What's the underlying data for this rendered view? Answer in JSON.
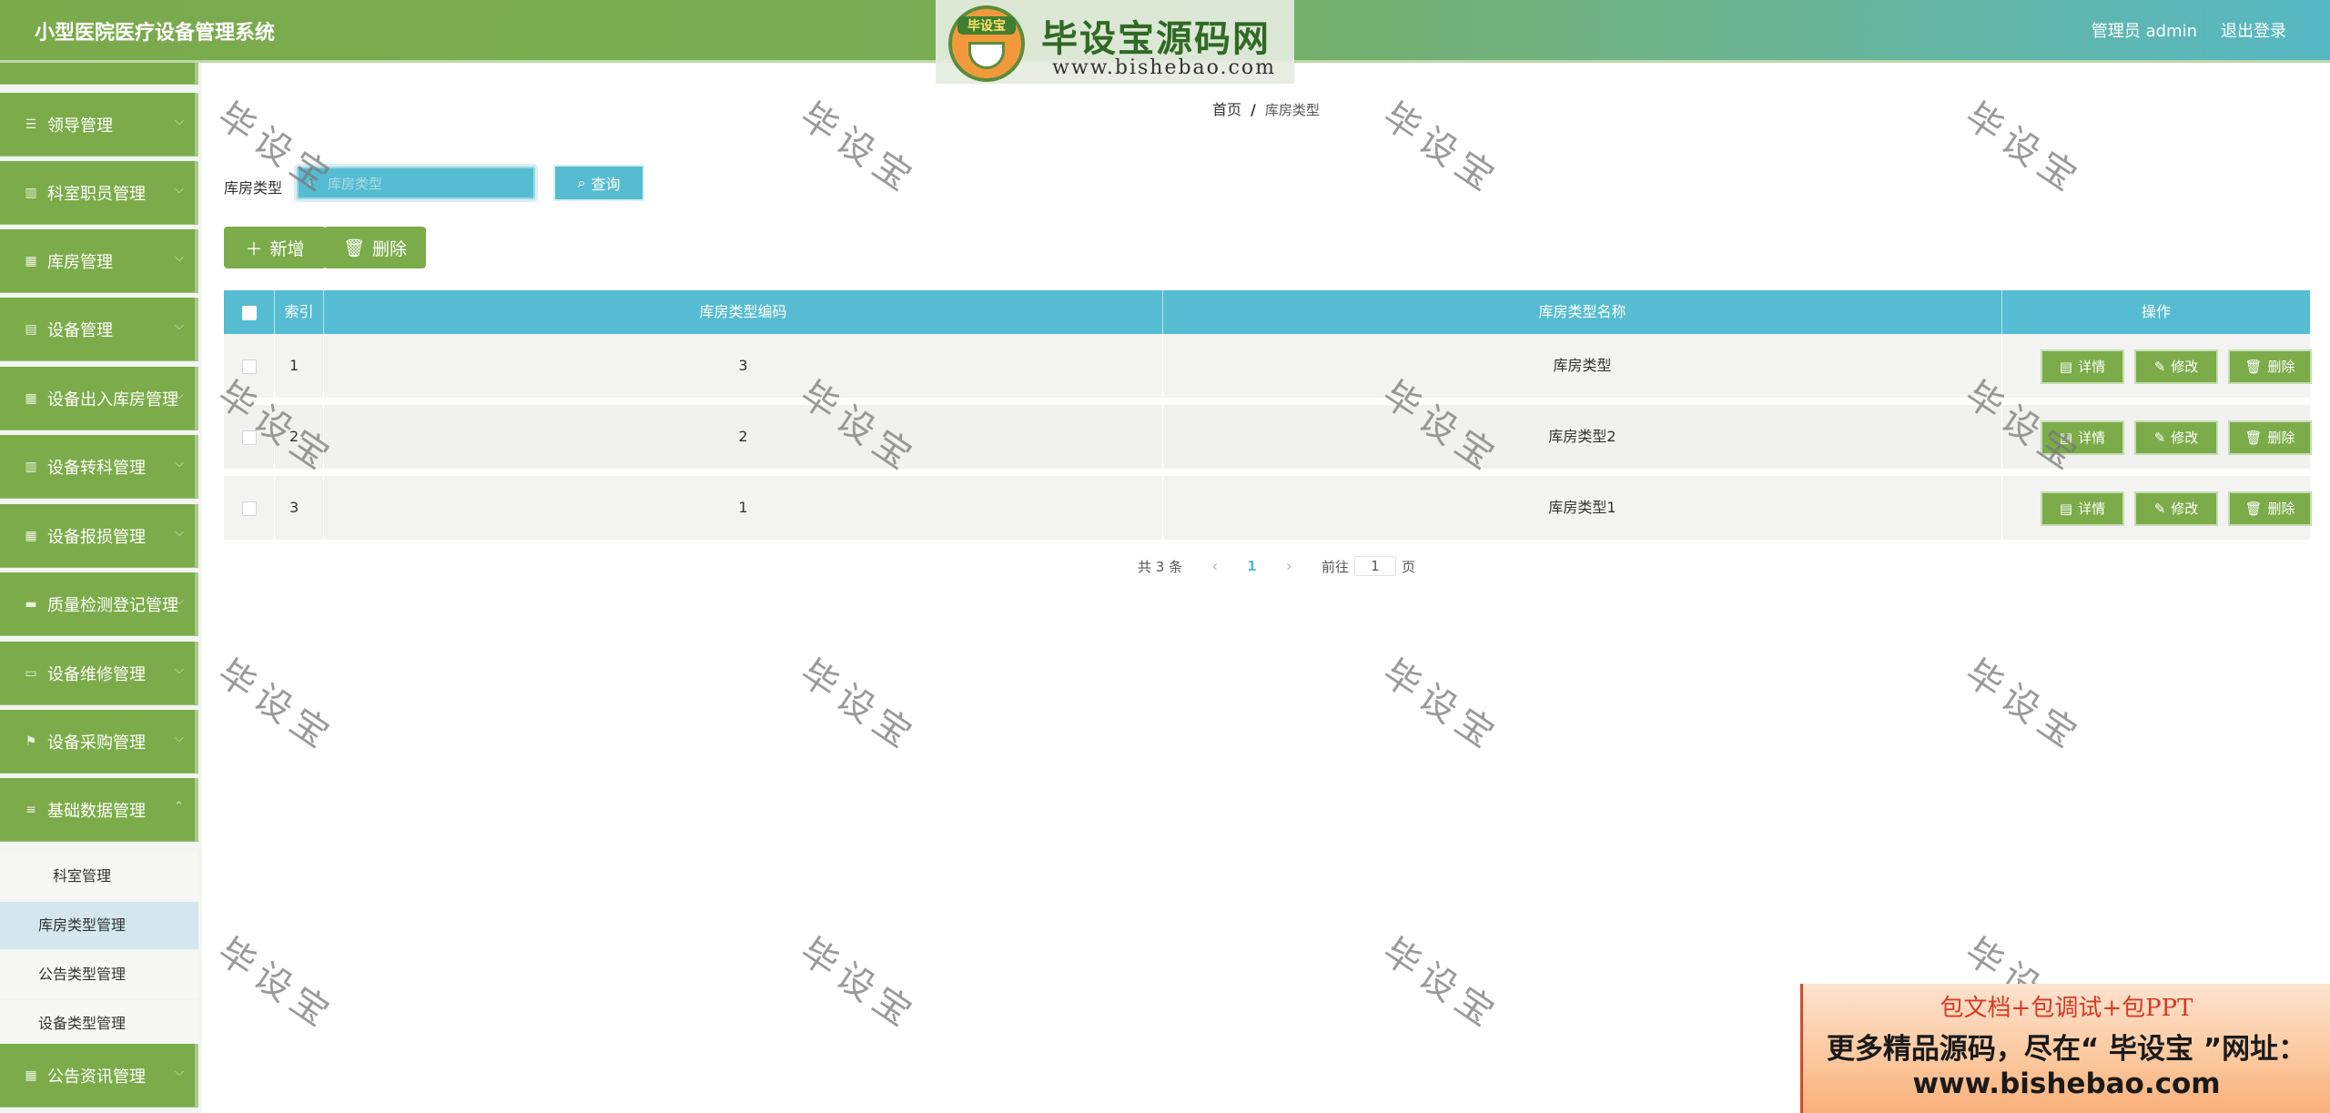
{
  "header": {
    "title": "小型医院医疗设备管理系统",
    "user_label": "管理员 admin",
    "logout_label": "退出登录"
  },
  "logo": {
    "badge": "毕设宝",
    "title": "毕设宝源码网",
    "url": "www.bishebao.com"
  },
  "sidebar": {
    "items": [
      {
        "label": "领导管理",
        "icon": "sliders-icon"
      },
      {
        "label": "科室职员管理",
        "icon": "bar-chart-icon"
      },
      {
        "label": "库房管理",
        "icon": "grid-icon"
      },
      {
        "label": "设备管理",
        "icon": "clipboard-icon"
      },
      {
        "label": "设备出入库房管理",
        "icon": "grid-icon"
      },
      {
        "label": "设备转科管理",
        "icon": "bar-chart-icon"
      },
      {
        "label": "设备报损管理",
        "icon": "grid-icon"
      },
      {
        "label": "质量检测登记管理",
        "icon": "message-icon"
      },
      {
        "label": "设备维修管理",
        "icon": "monitor-icon"
      },
      {
        "label": "设备采购管理",
        "icon": "flag-icon"
      },
      {
        "label": "基础数据管理",
        "icon": "list-icon"
      }
    ],
    "sub_items": [
      "科室管理",
      "库房类型管理",
      "公告类型管理",
      "设备类型管理"
    ],
    "last_item": {
      "label": "公告资讯管理",
      "icon": "grid-icon"
    }
  },
  "breadcrumb": {
    "home": "首页",
    "sep": "/",
    "current": "库房类型"
  },
  "search": {
    "label": "库房类型",
    "placeholder": "库房类型",
    "button": "查询"
  },
  "actions": {
    "add": "新增",
    "delete": "删除"
  },
  "table": {
    "headers": [
      "索引",
      "库房类型编码",
      "库房类型名称",
      "操作"
    ],
    "rows": [
      {
        "index": "1",
        "code": "3",
        "name": "库房类型"
      },
      {
        "index": "2",
        "code": "2",
        "name": "库房类型2"
      },
      {
        "index": "3",
        "code": "1",
        "name": "库房类型1"
      }
    ],
    "ops": {
      "detail": "详情",
      "edit": "修改",
      "delete": "删除"
    }
  },
  "pagination": {
    "total": "共 3 条",
    "current": "1",
    "goto_prefix": "前往",
    "goto_value": "1",
    "goto_suffix": "页"
  },
  "watermark": "毕设宝",
  "ad": {
    "line1": "包文档+包调试+包PPT",
    "line2": "更多精品源码，尽在“ 毕设宝 ”网址：",
    "line3": "www.bishebao.com"
  },
  "colors": {
    "green": "#7bac49",
    "teal": "#55bcd1"
  }
}
